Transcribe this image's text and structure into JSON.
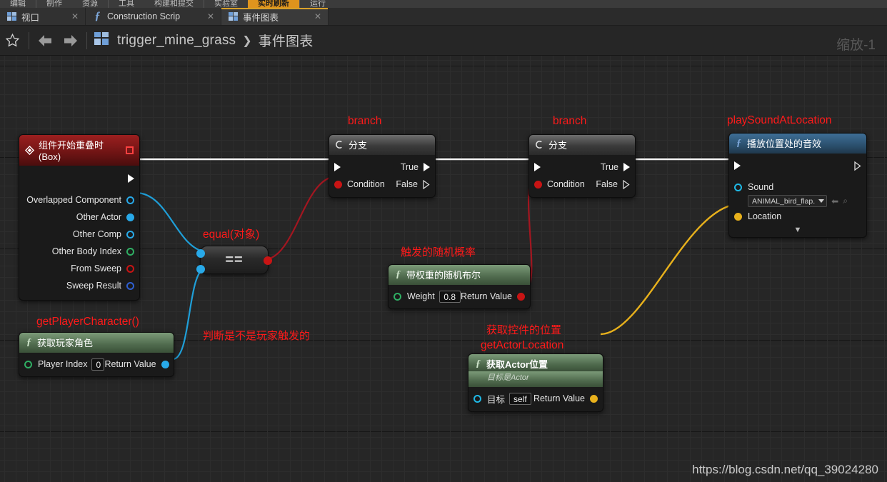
{
  "menubar": {
    "items": [
      "编辑",
      "制作",
      "资源",
      "工具",
      "构建和提交",
      "实验室"
    ],
    "accent_item": "实时刷新",
    "trailing_item": "运行"
  },
  "tabs": [
    {
      "label": "视口",
      "icon": "blueprint-icon",
      "active": false,
      "closable": true
    },
    {
      "label": "Construction Scrip",
      "icon": "function-icon",
      "active": false,
      "closable": true
    },
    {
      "label": "事件图表",
      "icon": "blueprint-icon",
      "active": true,
      "closable": true
    }
  ],
  "toolbar": {
    "favorite_icon": "star-icon",
    "back_icon": "arrow-left-icon",
    "forward_icon": "arrow-right-icon",
    "breadcrumb_icon": "blueprint-icon",
    "breadcrumb_root": "trigger_mine_grass",
    "breadcrumb_separator": "❯",
    "breadcrumb_leaf": "事件图表",
    "zoom_label": "缩放-1"
  },
  "canvas": {
    "watermark": "https://blog.csdn.net/qq_39024280"
  },
  "annotations": [
    {
      "id": "anno-equal",
      "text": "equal(对象)"
    },
    {
      "id": "anno-is-player",
      "text": "判断是不是玩家触发的"
    },
    {
      "id": "anno-branch-1",
      "text": "branch"
    },
    {
      "id": "anno-branch-2",
      "text": "branch"
    },
    {
      "id": "anno-random-chance",
      "text": "触发的随机概率"
    },
    {
      "id": "anno-play-sound",
      "text": "playSoundAtLocation"
    },
    {
      "id": "anno-get-player",
      "text": "getPlayerCharacter()"
    },
    {
      "id": "anno-widget-location",
      "text": "获取控件的位置"
    },
    {
      "id": "anno-get-actor-loc",
      "text": "getActorLocation"
    }
  ],
  "nodes": {
    "event_overlap": {
      "title": "组件开始重叠时 (Box)",
      "icon": "event-diamond-icon",
      "badge": "collapse-badge",
      "outputs": [
        {
          "label": "Overlapped Component",
          "pin": "object-pin",
          "color": "#28a9e8"
        },
        {
          "label": "Other Actor",
          "pin": "object-pin",
          "color": "#28a9e8",
          "filled": true
        },
        {
          "label": "Other Comp",
          "pin": "object-pin",
          "color": "#28a9e8"
        },
        {
          "label": "Other Body Index",
          "pin": "int-pin",
          "color": "#2fae63"
        },
        {
          "label": "From Sweep",
          "pin": "bool-pin",
          "color": "#c81414"
        },
        {
          "label": "Sweep Result",
          "pin": "struct-pin",
          "color": "#2f5fd0"
        }
      ]
    },
    "equal_object": {
      "glyph": "==",
      "input_pins": [
        "object-pin-a",
        "object-pin-b"
      ],
      "output_pin": "bool-pin"
    },
    "branch_1": {
      "title": "分支",
      "icon": "branch-icon",
      "exec_in": "exec-in-pin",
      "condition_label": "Condition",
      "true_label": "True",
      "false_label": "False"
    },
    "branch_2": {
      "title": "分支",
      "icon": "branch-icon",
      "exec_in": "exec-in-pin",
      "condition_label": "Condition",
      "true_label": "True",
      "false_label": "False"
    },
    "random_bool": {
      "title": "带权重的随机布尔",
      "icon": "function-icon",
      "input_label": "Weight",
      "input_value": "0.8",
      "output_label": "Return Value"
    },
    "get_player_character": {
      "title": "获取玩家角色",
      "icon": "function-icon",
      "input_label": "Player Index",
      "input_value": "0",
      "output_label": "Return Value"
    },
    "get_actor_location": {
      "title": "获取Actor位置",
      "subtitle": "目标是Actor",
      "icon": "function-icon",
      "input_label": "目标",
      "input_value": "self",
      "output_label": "Return Value"
    },
    "play_sound_at_location": {
      "title": "播放位置处的音效",
      "icon": "function-icon",
      "sound_label": "Sound",
      "sound_value": "ANIMAL_bird_flap.",
      "location_label": "Location",
      "expander": "▼",
      "browse_icon": "arrow-left-icon",
      "find_icon": "magnifier-icon"
    }
  },
  "colors": {
    "exec_white": "#ffffff",
    "bool_red": "#c81414",
    "object_blue": "#28a9e8",
    "int_green": "#2fae63",
    "vector_yellow": "#e8b11c",
    "struct_blue": "#2f5fd0",
    "annotation_red": "#ff1a1a",
    "accent_orange": "#e8991c"
  }
}
